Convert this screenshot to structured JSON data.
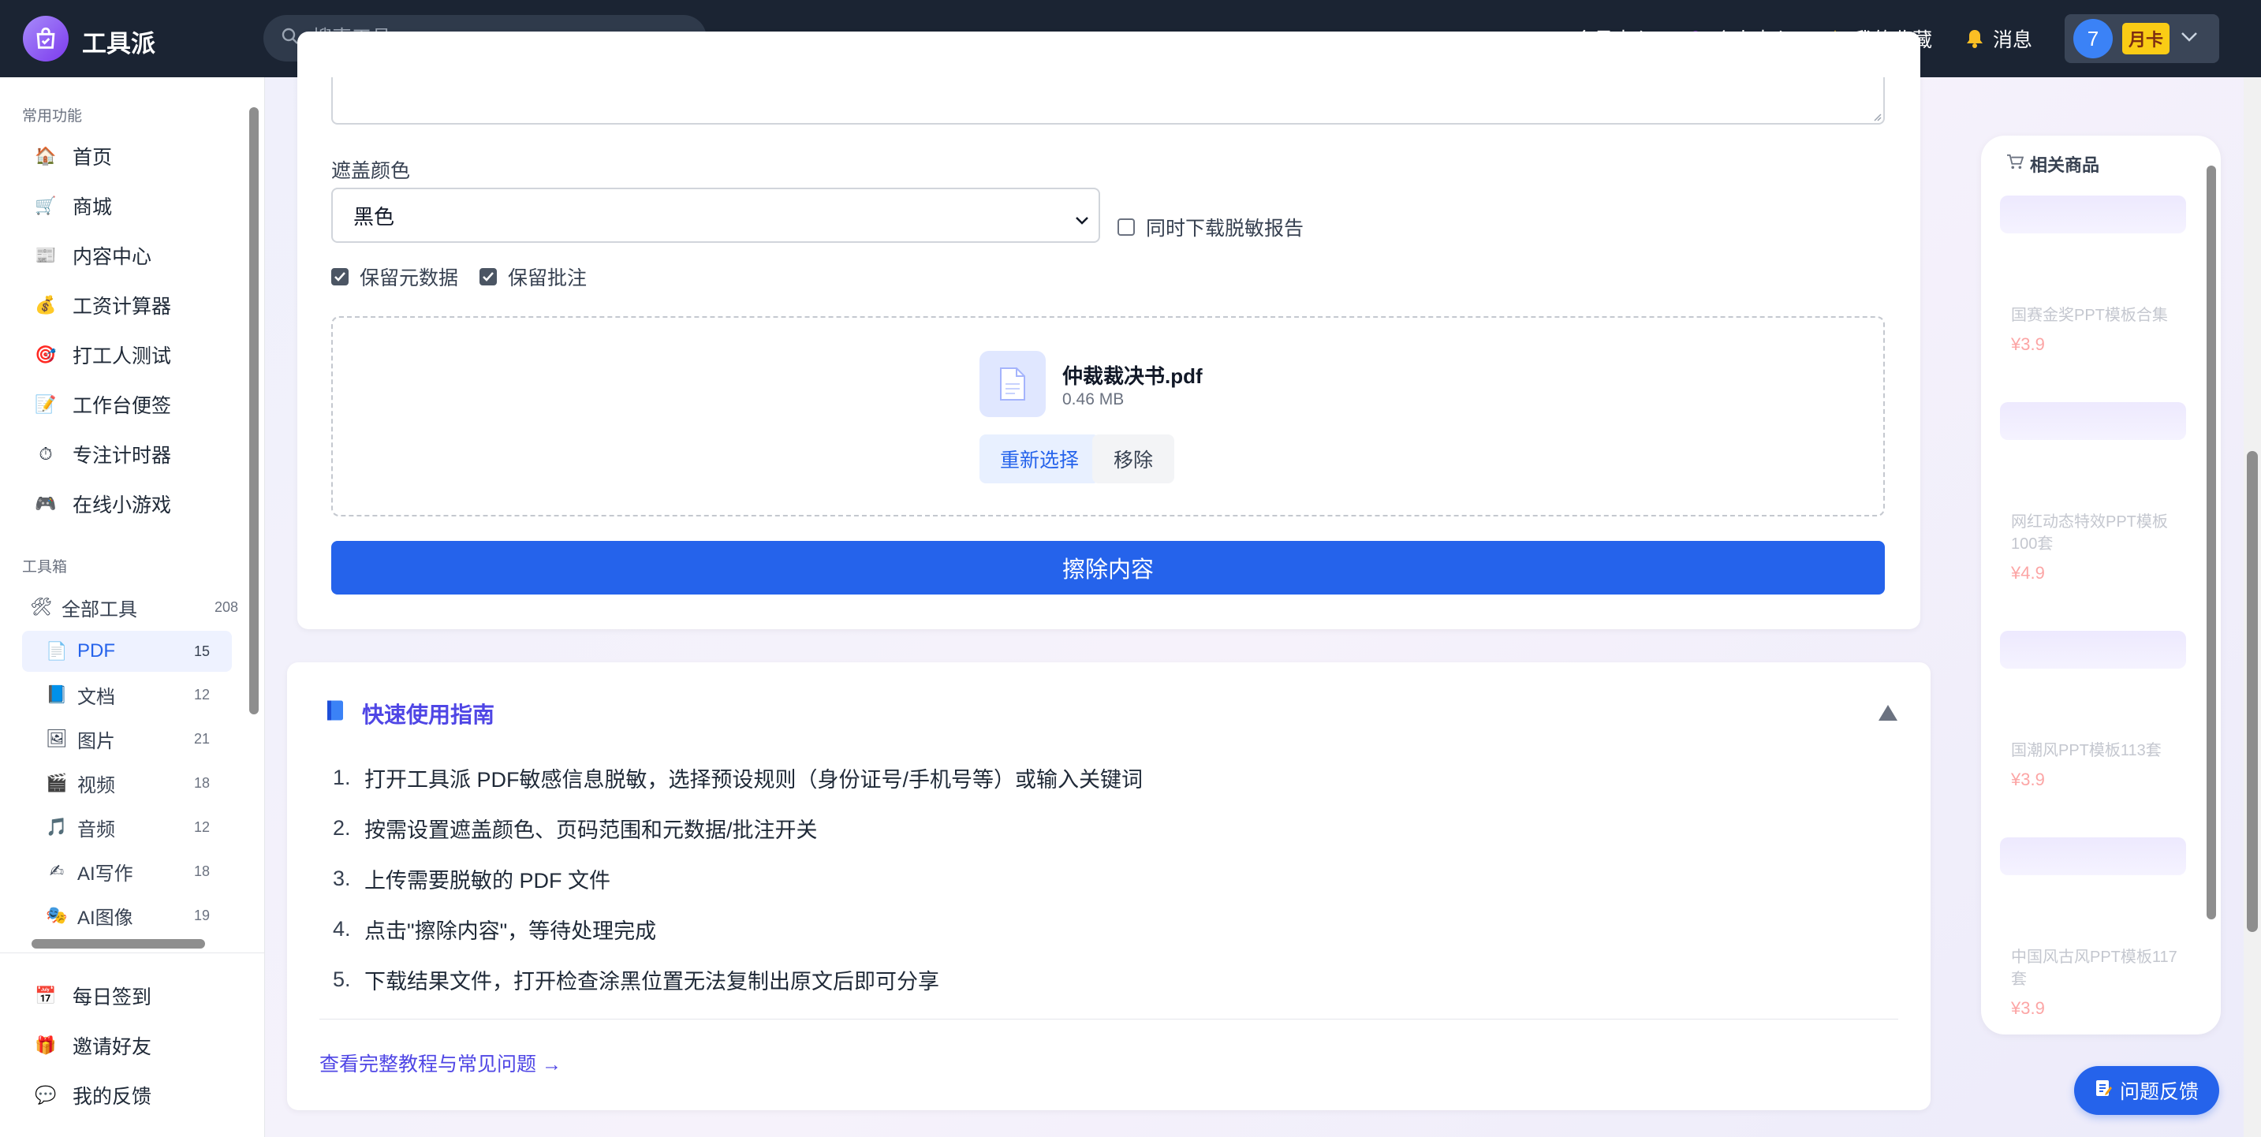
{
  "app": {
    "name": "工具派"
  },
  "search": {
    "placeholder": "搜索工具..."
  },
  "topnav": {
    "vip": "会员中心",
    "profile": "个人中心",
    "favorites": "我的收藏",
    "messages": "消息",
    "user_avatar": "7",
    "plan_badge": "月卡"
  },
  "sidebar": {
    "common_title": "常用功能",
    "common_items": [
      {
        "label": "首页",
        "icon": "home-icon"
      },
      {
        "label": "商城",
        "icon": "cart-icon"
      },
      {
        "label": "内容中心",
        "icon": "newspaper-icon"
      },
      {
        "label": "工资计算器",
        "icon": "money-bag-icon"
      },
      {
        "label": "打工人测试",
        "icon": "target-icon"
      },
      {
        "label": "工作台便签",
        "icon": "memo-icon"
      },
      {
        "label": "专注计时器",
        "icon": "stopwatch-icon"
      },
      {
        "label": "在线小游戏",
        "icon": "gamepad-icon"
      }
    ],
    "toolbox_title": "工具箱",
    "all_tools": {
      "label": "全部工具",
      "count": "208",
      "icon": "tools-icon"
    },
    "tools": [
      {
        "label": "PDF",
        "count": "15",
        "icon": "pdf-doc-icon",
        "active": true
      },
      {
        "label": "文档",
        "count": "12",
        "icon": "blue-book-icon"
      },
      {
        "label": "图片",
        "count": "21",
        "icon": "picture-icon"
      },
      {
        "label": "视频",
        "count": "18",
        "icon": "clapper-icon"
      },
      {
        "label": "音频",
        "count": "12",
        "icon": "music-note-icon"
      },
      {
        "label": "AI写作",
        "count": "18",
        "icon": "writing-hand-icon"
      },
      {
        "label": "AI图像",
        "count": "19",
        "icon": "art-masks-icon"
      }
    ],
    "bottom_items": [
      {
        "label": "每日签到",
        "icon": "calendar-icon"
      },
      {
        "label": "邀请好友",
        "icon": "gift-icon"
      },
      {
        "label": "我的反馈",
        "icon": "speech-bubble-icon"
      }
    ]
  },
  "form": {
    "cover_color_label": "遮盖颜色",
    "cover_color_value": "黑色",
    "download_report_label": "同时下载脱敏报告",
    "download_report_checked": false,
    "keep_metadata_label": "保留元数据",
    "keep_metadata_checked": true,
    "keep_annotations_label": "保留批注",
    "keep_annotations_checked": true,
    "file_name": "仲裁裁决书.pdf",
    "file_size": "0.46 MB",
    "reselect_label": "重新选择",
    "remove_label": "移除",
    "submit_label": "擦除内容"
  },
  "guide": {
    "title": "快速使用指南",
    "steps": [
      "打开工具派 PDF敏感信息脱敏，选择预设规则（身份证号/手机号等）或输入关键词",
      "按需设置遮盖颜色、页码范围和元数据/批注开关",
      "上传需要脱敏的 PDF 文件",
      "点击\"擦除内容\"，等待处理完成",
      "下载结果文件，打开检查涂黑位置无法复制出原文后即可分享"
    ],
    "step_numbers": [
      "1.",
      "2.",
      "3.",
      "4.",
      "5."
    ],
    "link": "查看完整教程与常见问题 →"
  },
  "related": {
    "title": "相关商品",
    "products": [
      {
        "name": "国赛金奖PPT模板合集",
        "price": "¥3.9"
      },
      {
        "name": "网红动态特效PPT模板100套",
        "price": "¥4.9"
      },
      {
        "name": "国潮风PPT模板113套",
        "price": "¥3.9"
      },
      {
        "name": "中国风古风PPT模板117套",
        "price": "¥3.9"
      }
    ]
  },
  "feedback_button": "问题反馈",
  "colors": {
    "accent": "#2563eb",
    "topbar": "#1b2433",
    "guide_title": "#4f46e5"
  }
}
